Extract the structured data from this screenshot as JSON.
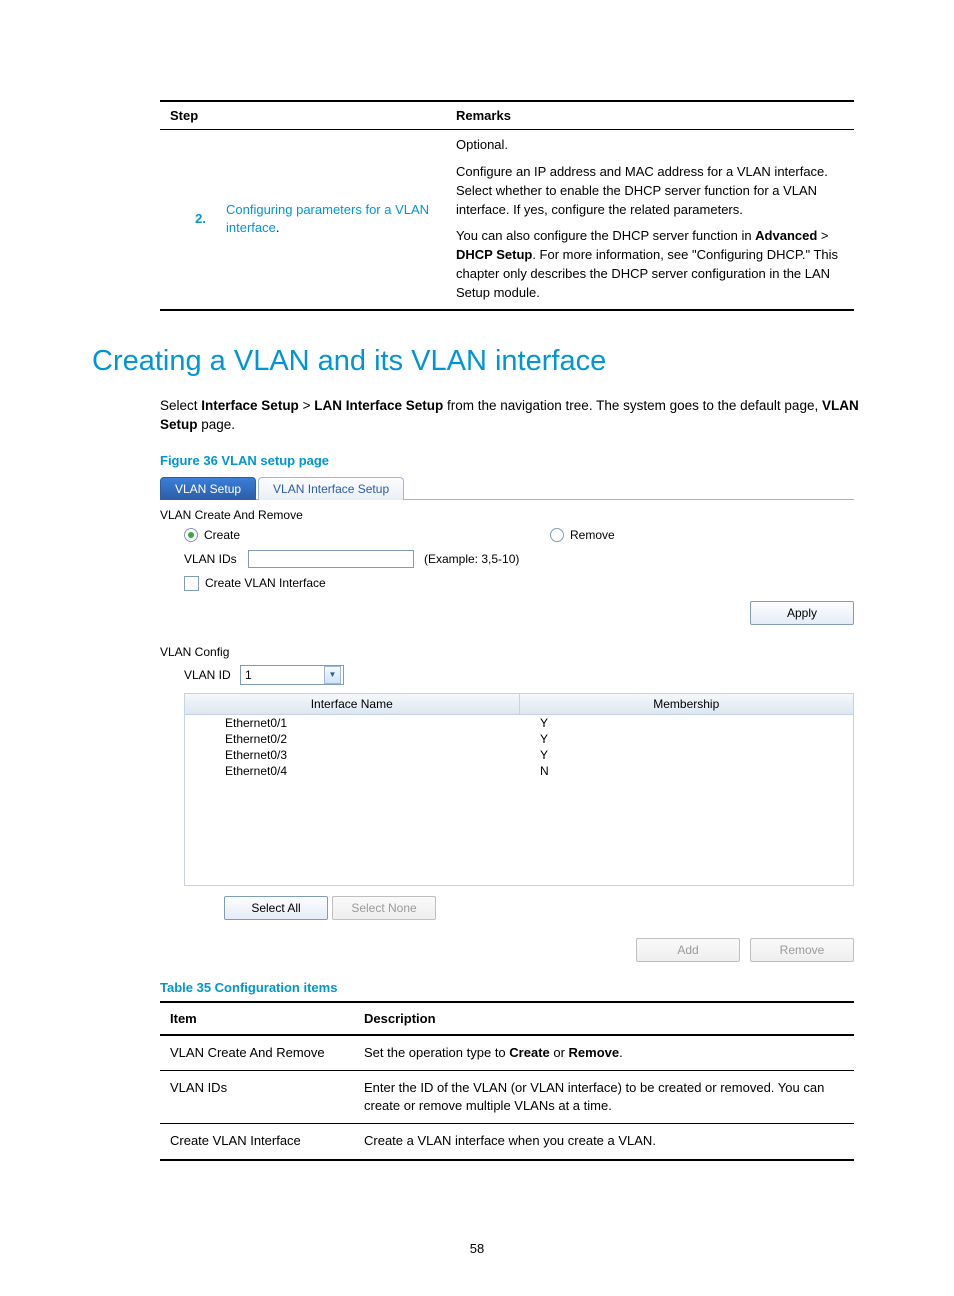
{
  "page_number": "58",
  "steps_table": {
    "headers": {
      "step": "Step",
      "remarks": "Remarks"
    },
    "row": {
      "num": "2.",
      "link_text": "Configuring parameters for a VLAN interface",
      "link_punct": ".",
      "remarks_p1": "Optional.",
      "remarks_p2": "Configure an IP address and MAC address for a VLAN interface. Select whether to enable the DHCP server function for a VLAN interface. If yes, configure the related parameters.",
      "remarks_p3_a": "You can also configure the DHCP server function in ",
      "remarks_p3_b": "Advanced",
      "remarks_p3_c": " > ",
      "remarks_p3_d": "DHCP Setup",
      "remarks_p3_e": ". For more information, see \"Configuring DHCP.\" This chapter only describes the DHCP server configuration in the LAN Setup module."
    }
  },
  "heading": "Creating a VLAN and its VLAN interface",
  "intro": {
    "a": "Select ",
    "b": "Interface Setup",
    "c": " > ",
    "d": "LAN Interface Setup",
    "e": " from the navigation tree. The system goes to the default page, ",
    "f": "VLAN Setup",
    "g": " page."
  },
  "figure_caption": "Figure 36 VLAN setup page",
  "screenshot": {
    "tabs": {
      "active": "VLAN Setup",
      "other": "VLAN Interface Setup"
    },
    "sec1_title": "VLAN Create And Remove",
    "radio_create": "Create",
    "radio_remove": "Remove",
    "vlan_ids_label": "VLAN IDs",
    "vlan_ids_hint": "(Example: 3,5-10)",
    "create_iface_label": "Create VLAN Interface",
    "apply": "Apply",
    "sec2_title": "VLAN Config",
    "vlan_id_label": "VLAN ID",
    "vlan_id_value": "1",
    "grid": {
      "col1": "Interface Name",
      "col2": "Membership",
      "rows": [
        {
          "name": "Ethernet0/1",
          "m": "Y"
        },
        {
          "name": "Ethernet0/2",
          "m": "Y"
        },
        {
          "name": "Ethernet0/3",
          "m": "Y"
        },
        {
          "name": "Ethernet0/4",
          "m": "N"
        }
      ]
    },
    "select_all": "Select All",
    "select_none": "Select None",
    "add": "Add",
    "remove": "Remove"
  },
  "table_caption": "Table 35 Configuration items",
  "config_table": {
    "headers": {
      "item": "Item",
      "desc": "Description"
    },
    "rows": [
      {
        "item": "VLAN Create And Remove",
        "desc_a": "Set the operation type to ",
        "desc_b": "Create",
        "desc_c": " or ",
        "desc_d": "Remove",
        "desc_e": "."
      },
      {
        "item": "VLAN IDs",
        "desc_plain": "Enter the ID of the VLAN (or VLAN interface) to be created or removed. You can create or remove multiple VLANs at a time."
      },
      {
        "item": "Create VLAN Interface",
        "desc_plain": "Create a VLAN interface when you create a VLAN."
      }
    ]
  }
}
